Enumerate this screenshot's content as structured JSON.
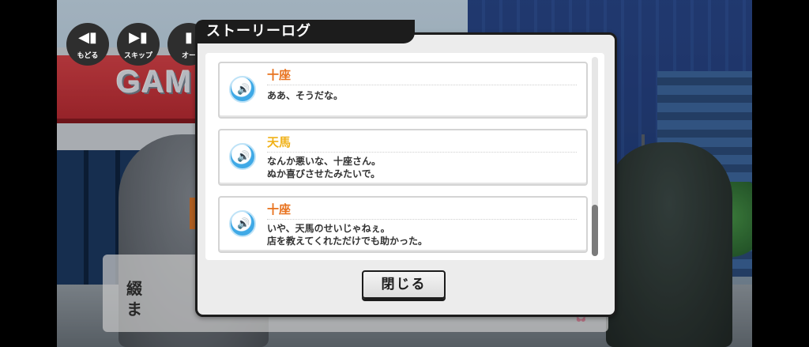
{
  "background": {
    "store_sign": "GAM",
    "message_box_lines": [
      "綴",
      "ま"
    ]
  },
  "controls": [
    {
      "glyph": "◀▮",
      "label": "もどる"
    },
    {
      "glyph": "▶▮",
      "label": "スキップ"
    },
    {
      "glyph": "▮",
      "label": "オー"
    }
  ],
  "modal": {
    "title": "ストーリーログ",
    "close_label": "閉じる",
    "entries": [
      {
        "speaker": "十座",
        "speaker_color": "#e8721e",
        "lines": [
          "ああ、そうだな。"
        ]
      },
      {
        "speaker": "天馬",
        "speaker_color": "#f0b21a",
        "lines": [
          "なんか悪いな、十座さん。",
          "ぬか喜びさせたみたいで。"
        ]
      },
      {
        "speaker": "十座",
        "speaker_color": "#e8721e",
        "lines": [
          "いや、天馬のせいじゃねぇ。",
          "店を教えてくれただけでも助かった。"
        ]
      }
    ],
    "scroll_position": 1.0
  }
}
